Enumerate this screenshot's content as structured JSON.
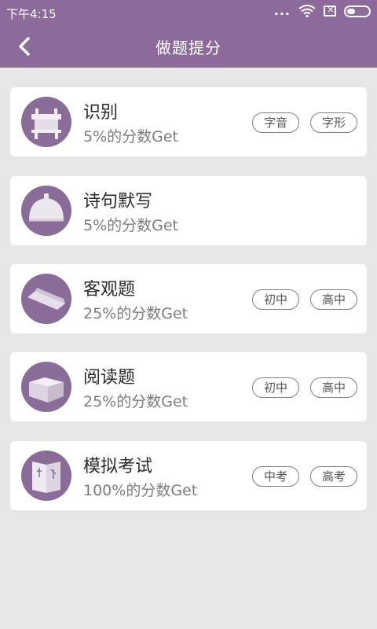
{
  "status_bar": {
    "time": "下午4:15",
    "signal_dots": "..."
  },
  "header": {
    "title": "做题提分"
  },
  "items": [
    {
      "title": "识别",
      "subtitle": "5%的分数Get",
      "icon": "bronze-vessel-icon",
      "tags": [
        "字音",
        "字形"
      ]
    },
    {
      "title": "诗句默写",
      "subtitle": "5%的分数Get",
      "icon": "bell-icon",
      "tags": []
    },
    {
      "title": "客观题",
      "subtitle": "25%的分数Get",
      "icon": "ink-stick-icon",
      "tags": [
        "初中",
        "高中"
      ]
    },
    {
      "title": "阅读题",
      "subtitle": "25%的分数Get",
      "icon": "box-icon",
      "tags": [
        "初中",
        "高中"
      ]
    },
    {
      "title": "模拟考试",
      "subtitle": "100%的分数Get",
      "icon": "book-icon",
      "tags": [
        "中考",
        "高考"
      ]
    }
  ],
  "colors": {
    "accent": "#8c6a9b",
    "icon_bg": "#8a6c99",
    "background": "#e6e6e6"
  }
}
